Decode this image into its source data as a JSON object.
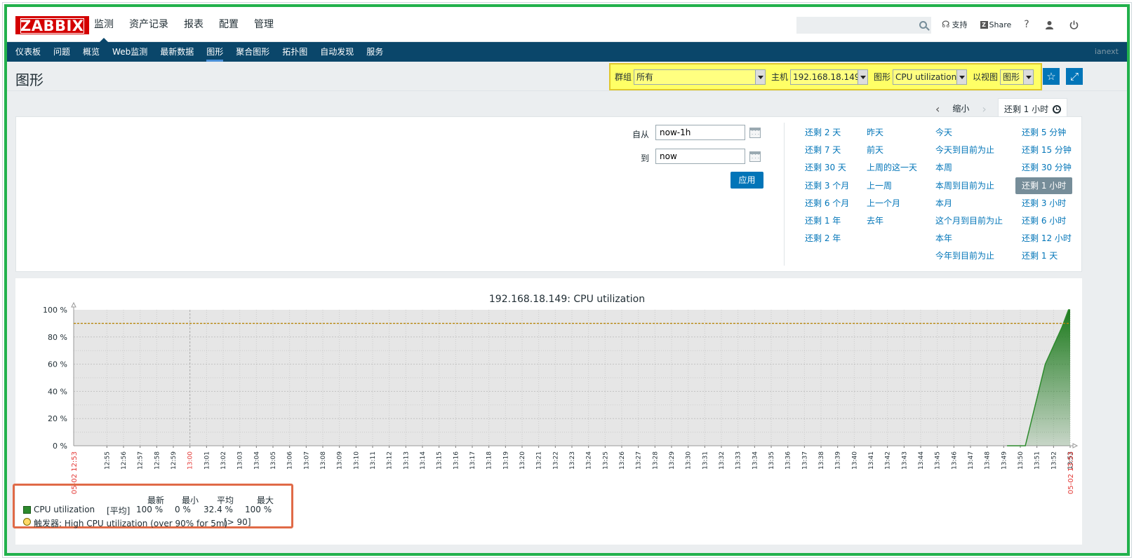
{
  "logo": {
    "text": "ZABBIX"
  },
  "main_menu": [
    "监测",
    "资产记录",
    "报表",
    "配置",
    "管理"
  ],
  "search": {
    "value": "",
    "placeholder": ""
  },
  "top_tools": {
    "support": "支持",
    "share": "Share",
    "help": "?"
  },
  "sub_menu": [
    "仪表板",
    "问题",
    "概览",
    "Web监测",
    "最新数据",
    "图形",
    "聚合图形",
    "拓扑图",
    "自动发现",
    "服务"
  ],
  "user": "ianext",
  "page_title": "图形",
  "filter": {
    "group_label": "群组",
    "group_value": "所有",
    "host_label": "主机",
    "host_value": "192.168.18.149",
    "graph_label": "图形",
    "graph_value": "CPU utilization",
    "view_label": "以视图",
    "view_value": "图形"
  },
  "time_tabs": {
    "zoom_out": "缩小",
    "selected": "还剩 1 小时"
  },
  "time_filter": {
    "from_label": "自从",
    "from_value": "now-1h",
    "to_label": "到",
    "to_value": "now",
    "apply": "应用"
  },
  "quick_ranges": [
    [
      "还剩 2 天",
      "还剩 7 天",
      "还剩 30 天",
      "还剩 3 个月",
      "还剩 6 个月",
      "还剩 1 年",
      "还剩 2 年"
    ],
    [
      "昨天",
      "前天",
      "上周的这一天",
      "上一周",
      "上一个月",
      "去年"
    ],
    [
      "今天",
      "今天到目前为止",
      "本周",
      "本周到目前为止",
      "本月",
      "这个月到目前为止",
      "本年",
      "今年到目前为止"
    ],
    [
      "还剩 5 分钟",
      "还剩 15 分钟",
      "还剩 30 分钟",
      "还剩 1 小时",
      "还剩 3 小时",
      "还剩 6 小时",
      "还剩 12 小时",
      "还剩 1 天"
    ]
  ],
  "quick_selected": "还剩 1 小时",
  "chart_data": {
    "type": "area",
    "title": "192.168.18.149: CPU utilization",
    "y_ticks": [
      "0 %",
      "20 %",
      "40 %",
      "60 %",
      "80 %",
      "100 %"
    ],
    "ylim": [
      0,
      100
    ],
    "x_start_label": "05-02 12:53",
    "x_end_label": "05-02 13:53",
    "x_ticks": [
      "12:55",
      "12:56",
      "12:57",
      "12:58",
      "12:59",
      "13:00",
      "13:01",
      "13:02",
      "13:03",
      "13:04",
      "13:05",
      "13:06",
      "13:07",
      "13:08",
      "13:09",
      "13:10",
      "13:11",
      "13:12",
      "13:13",
      "13:14",
      "13:15",
      "13:16",
      "13:17",
      "13:18",
      "13:19",
      "13:20",
      "13:21",
      "13:22",
      "13:23",
      "13:24",
      "13:25",
      "13:26",
      "13:27",
      "13:28",
      "13:29",
      "13:30",
      "13:31",
      "13:32",
      "13:33",
      "13:34",
      "13:35",
      "13:36",
      "13:37",
      "13:38",
      "13:39",
      "13:40",
      "13:41",
      "13:42",
      "13:43",
      "13:44",
      "13:45",
      "13:46",
      "13:47",
      "13:48",
      "13:49",
      "13:50",
      "13:51",
      "13:52",
      "13:53"
    ],
    "highlight_ticks": [
      "13:00"
    ],
    "series": [
      {
        "name": "CPU utilization",
        "color": "#2d8a2d",
        "points": [
          [
            56.2,
            0
          ],
          [
            57.3,
            0
          ],
          [
            58.5,
            60
          ],
          [
            59.5,
            87
          ],
          [
            59.9,
            100
          ],
          [
            60.0,
            100
          ]
        ]
      }
    ],
    "threshold": {
      "value": 90,
      "color": "#b8860b"
    },
    "grid": true
  },
  "legend": {
    "headers": [
      "最新",
      "最小",
      "平均",
      "最大"
    ],
    "items": [
      {
        "name": "CPU utilization",
        "type": "[平均]",
        "values": [
          "100 %",
          "0 %",
          "32.4 %",
          "100 %"
        ]
      },
      {
        "name": "触发器: High CPU utilization (over 90% for 5m)",
        "value": "[> 90]"
      }
    ]
  },
  "colors": {
    "accent": "#0275b8",
    "nav": "#0a466a",
    "annotation_green": "#22b14c",
    "annotation_yellow": "#ffff66",
    "annotation_orange": "#e06a47"
  }
}
